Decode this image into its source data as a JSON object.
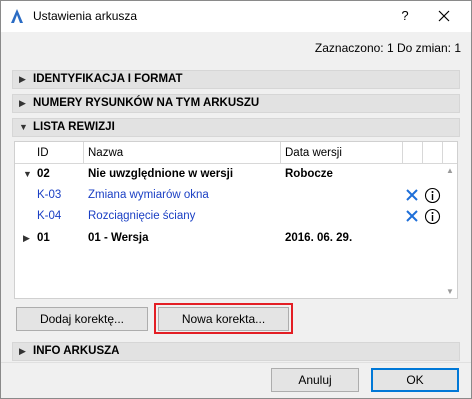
{
  "window": {
    "title": "Ustawienia arkusza",
    "help_label": "?",
    "close_icon": "close-icon",
    "app_icon": "archicad-icon"
  },
  "status": "Zaznaczono: 1 Do zmian: 1",
  "sections": {
    "identification": "IDENTYFIKACJA I FORMAT",
    "drawing_numbers": "NUMERY RYSUNKÓW NA TYM ARKUSZU",
    "revision_list": "LISTA REWIZJI",
    "sheet_info": "INFO ARKUSZA"
  },
  "revision_table": {
    "headers": {
      "id": "ID",
      "name": "Nazwa",
      "date": "Data wersji"
    },
    "rows": [
      {
        "type": "group",
        "expanded": true,
        "id": "02",
        "name": "Nie uwzględnione w wersji",
        "date": "Robocze"
      },
      {
        "type": "item",
        "id": "K-03",
        "name": "Zmiana wymiarów okna",
        "date": ""
      },
      {
        "type": "item",
        "id": "K-04",
        "name": "Rozciągnięcie ściany",
        "date": ""
      },
      {
        "type": "group",
        "expanded": false,
        "id": "01",
        "name": "01 - Wersja",
        "date": "2016. 06. 29."
      }
    ]
  },
  "buttons": {
    "add_correction": "Dodaj korektę...",
    "new_correction": "Nowa korekta...",
    "cancel": "Anuluj",
    "ok": "OK"
  },
  "colors": {
    "accent_blue": "#1a3fc4",
    "highlight_red": "#e31e24",
    "x_icon_blue": "#1e6fd9"
  }
}
